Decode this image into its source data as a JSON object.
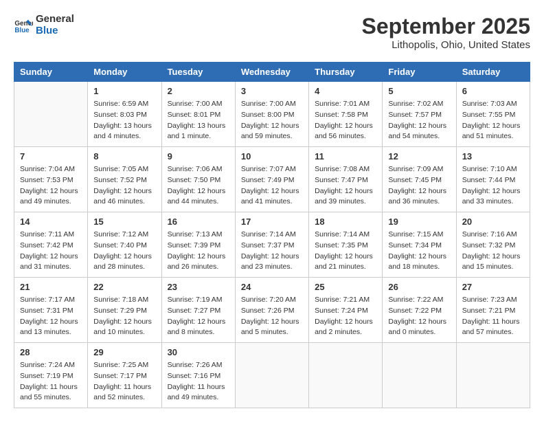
{
  "logo": {
    "text1": "General",
    "text2": "Blue"
  },
  "title": "September 2025",
  "subtitle": "Lithopolis, Ohio, United States",
  "days_of_week": [
    "Sunday",
    "Monday",
    "Tuesday",
    "Wednesday",
    "Thursday",
    "Friday",
    "Saturday"
  ],
  "weeks": [
    [
      {
        "day": "",
        "sunrise": "",
        "sunset": "",
        "daylight": ""
      },
      {
        "day": "1",
        "sunrise": "Sunrise: 6:59 AM",
        "sunset": "Sunset: 8:03 PM",
        "daylight": "Daylight: 13 hours and 4 minutes."
      },
      {
        "day": "2",
        "sunrise": "Sunrise: 7:00 AM",
        "sunset": "Sunset: 8:01 PM",
        "daylight": "Daylight: 13 hours and 1 minute."
      },
      {
        "day": "3",
        "sunrise": "Sunrise: 7:00 AM",
        "sunset": "Sunset: 8:00 PM",
        "daylight": "Daylight: 12 hours and 59 minutes."
      },
      {
        "day": "4",
        "sunrise": "Sunrise: 7:01 AM",
        "sunset": "Sunset: 7:58 PM",
        "daylight": "Daylight: 12 hours and 56 minutes."
      },
      {
        "day": "5",
        "sunrise": "Sunrise: 7:02 AM",
        "sunset": "Sunset: 7:57 PM",
        "daylight": "Daylight: 12 hours and 54 minutes."
      },
      {
        "day": "6",
        "sunrise": "Sunrise: 7:03 AM",
        "sunset": "Sunset: 7:55 PM",
        "daylight": "Daylight: 12 hours and 51 minutes."
      }
    ],
    [
      {
        "day": "7",
        "sunrise": "Sunrise: 7:04 AM",
        "sunset": "Sunset: 7:53 PM",
        "daylight": "Daylight: 12 hours and 49 minutes."
      },
      {
        "day": "8",
        "sunrise": "Sunrise: 7:05 AM",
        "sunset": "Sunset: 7:52 PM",
        "daylight": "Daylight: 12 hours and 46 minutes."
      },
      {
        "day": "9",
        "sunrise": "Sunrise: 7:06 AM",
        "sunset": "Sunset: 7:50 PM",
        "daylight": "Daylight: 12 hours and 44 minutes."
      },
      {
        "day": "10",
        "sunrise": "Sunrise: 7:07 AM",
        "sunset": "Sunset: 7:49 PM",
        "daylight": "Daylight: 12 hours and 41 minutes."
      },
      {
        "day": "11",
        "sunrise": "Sunrise: 7:08 AM",
        "sunset": "Sunset: 7:47 PM",
        "daylight": "Daylight: 12 hours and 39 minutes."
      },
      {
        "day": "12",
        "sunrise": "Sunrise: 7:09 AM",
        "sunset": "Sunset: 7:45 PM",
        "daylight": "Daylight: 12 hours and 36 minutes."
      },
      {
        "day": "13",
        "sunrise": "Sunrise: 7:10 AM",
        "sunset": "Sunset: 7:44 PM",
        "daylight": "Daylight: 12 hours and 33 minutes."
      }
    ],
    [
      {
        "day": "14",
        "sunrise": "Sunrise: 7:11 AM",
        "sunset": "Sunset: 7:42 PM",
        "daylight": "Daylight: 12 hours and 31 minutes."
      },
      {
        "day": "15",
        "sunrise": "Sunrise: 7:12 AM",
        "sunset": "Sunset: 7:40 PM",
        "daylight": "Daylight: 12 hours and 28 minutes."
      },
      {
        "day": "16",
        "sunrise": "Sunrise: 7:13 AM",
        "sunset": "Sunset: 7:39 PM",
        "daylight": "Daylight: 12 hours and 26 minutes."
      },
      {
        "day": "17",
        "sunrise": "Sunrise: 7:14 AM",
        "sunset": "Sunset: 7:37 PM",
        "daylight": "Daylight: 12 hours and 23 minutes."
      },
      {
        "day": "18",
        "sunrise": "Sunrise: 7:14 AM",
        "sunset": "Sunset: 7:35 PM",
        "daylight": "Daylight: 12 hours and 21 minutes."
      },
      {
        "day": "19",
        "sunrise": "Sunrise: 7:15 AM",
        "sunset": "Sunset: 7:34 PM",
        "daylight": "Daylight: 12 hours and 18 minutes."
      },
      {
        "day": "20",
        "sunrise": "Sunrise: 7:16 AM",
        "sunset": "Sunset: 7:32 PM",
        "daylight": "Daylight: 12 hours and 15 minutes."
      }
    ],
    [
      {
        "day": "21",
        "sunrise": "Sunrise: 7:17 AM",
        "sunset": "Sunset: 7:31 PM",
        "daylight": "Daylight: 12 hours and 13 minutes."
      },
      {
        "day": "22",
        "sunrise": "Sunrise: 7:18 AM",
        "sunset": "Sunset: 7:29 PM",
        "daylight": "Daylight: 12 hours and 10 minutes."
      },
      {
        "day": "23",
        "sunrise": "Sunrise: 7:19 AM",
        "sunset": "Sunset: 7:27 PM",
        "daylight": "Daylight: 12 hours and 8 minutes."
      },
      {
        "day": "24",
        "sunrise": "Sunrise: 7:20 AM",
        "sunset": "Sunset: 7:26 PM",
        "daylight": "Daylight: 12 hours and 5 minutes."
      },
      {
        "day": "25",
        "sunrise": "Sunrise: 7:21 AM",
        "sunset": "Sunset: 7:24 PM",
        "daylight": "Daylight: 12 hours and 2 minutes."
      },
      {
        "day": "26",
        "sunrise": "Sunrise: 7:22 AM",
        "sunset": "Sunset: 7:22 PM",
        "daylight": "Daylight: 12 hours and 0 minutes."
      },
      {
        "day": "27",
        "sunrise": "Sunrise: 7:23 AM",
        "sunset": "Sunset: 7:21 PM",
        "daylight": "Daylight: 11 hours and 57 minutes."
      }
    ],
    [
      {
        "day": "28",
        "sunrise": "Sunrise: 7:24 AM",
        "sunset": "Sunset: 7:19 PM",
        "daylight": "Daylight: 11 hours and 55 minutes."
      },
      {
        "day": "29",
        "sunrise": "Sunrise: 7:25 AM",
        "sunset": "Sunset: 7:17 PM",
        "daylight": "Daylight: 11 hours and 52 minutes."
      },
      {
        "day": "30",
        "sunrise": "Sunrise: 7:26 AM",
        "sunset": "Sunset: 7:16 PM",
        "daylight": "Daylight: 11 hours and 49 minutes."
      },
      {
        "day": "",
        "sunrise": "",
        "sunset": "",
        "daylight": ""
      },
      {
        "day": "",
        "sunrise": "",
        "sunset": "",
        "daylight": ""
      },
      {
        "day": "",
        "sunrise": "",
        "sunset": "",
        "daylight": ""
      },
      {
        "day": "",
        "sunrise": "",
        "sunset": "",
        "daylight": ""
      }
    ]
  ]
}
